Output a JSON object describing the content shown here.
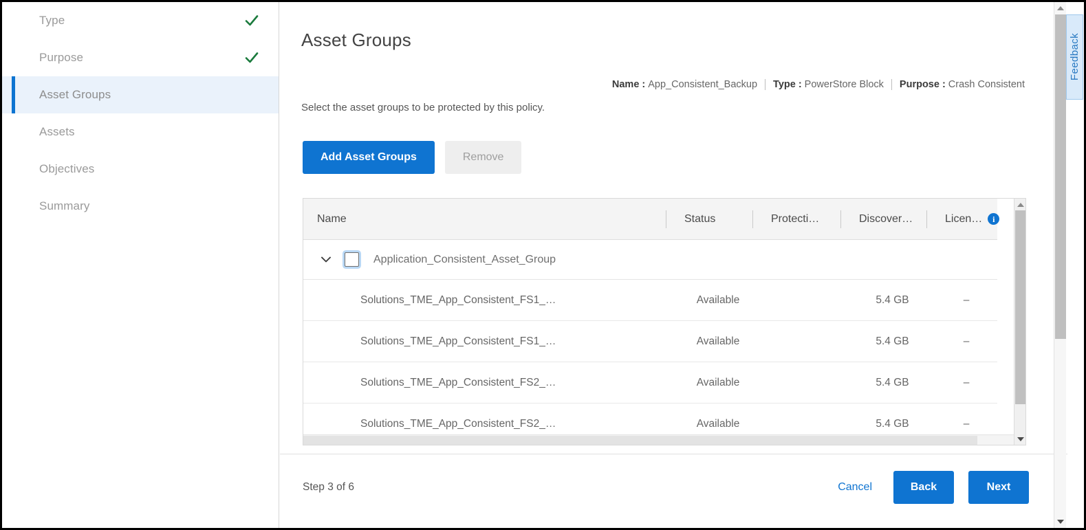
{
  "sidebar": {
    "items": [
      {
        "label": "Type",
        "completed": true,
        "active": false
      },
      {
        "label": "Purpose",
        "completed": true,
        "active": false
      },
      {
        "label": "Asset Groups",
        "completed": false,
        "active": true
      },
      {
        "label": "Assets",
        "completed": false,
        "active": false
      },
      {
        "label": "Objectives",
        "completed": false,
        "active": false
      },
      {
        "label": "Summary",
        "completed": false,
        "active": false
      }
    ]
  },
  "main": {
    "page_title": "Asset Groups",
    "subtitle": "Select the asset groups to be protected by this policy.",
    "meta": [
      {
        "key": "Name",
        "value": "App_Consistent_Backup"
      },
      {
        "key": "Type",
        "value": "PowerStore Block"
      },
      {
        "key": "Purpose",
        "value": "Crash Consistent"
      }
    ],
    "actions": {
      "add_label": "Add Asset Groups",
      "remove_label": "Remove"
    },
    "table": {
      "columns": [
        "Name",
        "Status",
        "Protecti…",
        "Discover…",
        "Licen…"
      ],
      "header_info_icon": "info-icon",
      "group": {
        "name": "Application_Consistent_Asset_Group",
        "expanded": true,
        "checked": false,
        "chevron": "chevron-down-icon"
      },
      "rows": [
        {
          "name": "Solutions_TME_App_Consistent_FS1_…",
          "status": "Available",
          "protection": "",
          "discovered": "5.4 GB",
          "license": "–"
        },
        {
          "name": "Solutions_TME_App_Consistent_FS1_…",
          "status": "Available",
          "protection": "",
          "discovered": "5.4 GB",
          "license": "–"
        },
        {
          "name": "Solutions_TME_App_Consistent_FS2_…",
          "status": "Available",
          "protection": "",
          "discovered": "5.4 GB",
          "license": "–"
        },
        {
          "name": "Solutions_TME_App_Consistent_FS2_…",
          "status": "Available",
          "protection": "",
          "discovered": "5.4 GB",
          "license": "–"
        }
      ]
    }
  },
  "footer": {
    "step_text": "Step 3 of 6",
    "cancel_label": "Cancel",
    "back_label": "Back",
    "next_label": "Next"
  },
  "feedback": {
    "label": "Feedback"
  },
  "colors": {
    "accent": "#0f74d1",
    "check_green": "#1a7a3c",
    "active_bg": "#eaf2fb",
    "feedback_bg": "#d9eafa",
    "feedback_text": "#2a7ac2"
  }
}
